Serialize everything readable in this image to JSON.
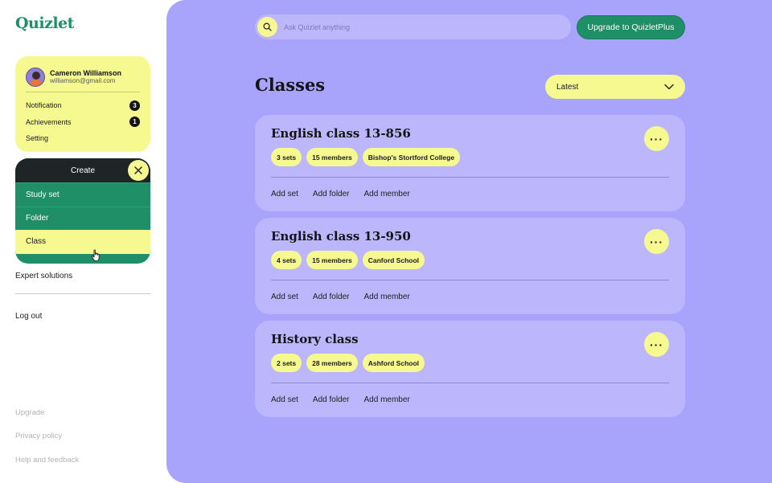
{
  "brand": {
    "logo": "Quizlet"
  },
  "profile": {
    "name": "Cameron Williamson",
    "email": "williamson@gmail.com",
    "items": [
      {
        "label": "Notification",
        "badge": "3"
      },
      {
        "label": "Achievements",
        "badge": "1"
      },
      {
        "label": "Setting",
        "badge": ""
      }
    ]
  },
  "create_menu": {
    "label": "Create",
    "items": [
      "Study set",
      "Folder",
      "Class"
    ],
    "active_item": "Class"
  },
  "sidebar": {
    "expert_solutions": "Expert solutions",
    "logout": "Log out",
    "footer": [
      "Upgrade",
      "Privacy policy",
      "Help and feedback"
    ]
  },
  "search": {
    "placeholder": "Ask Quizlet anything"
  },
  "upgrade_button": "Upgrade to QuizletPlus",
  "page": {
    "title": "Classes",
    "sort": "Latest"
  },
  "classes": [
    {
      "title": "English class 13-856",
      "chips": [
        "3 sets",
        "15  members",
        "Bishop's Stortford College"
      ],
      "actions": [
        "Add set",
        "Add folder",
        "Add member"
      ]
    },
    {
      "title": "English class 13-950",
      "chips": [
        "4 sets",
        "15  members",
        "Canford School"
      ],
      "actions": [
        "Add set",
        "Add folder",
        "Add member"
      ]
    },
    {
      "title": "History class",
      "chips": [
        "2 sets",
        "28 members",
        "Ashford School"
      ],
      "actions": [
        "Add set",
        "Add folder",
        "Add member"
      ]
    }
  ],
  "colors": {
    "brand_green": "#1f8f67",
    "panel_purple": "#a8a3fb",
    "card_purple": "#bcb7fc",
    "accent_yellow": "#f5f990",
    "dark": "#1f2427"
  },
  "icons": {
    "search": "search-icon",
    "close": "close-icon",
    "chevron": "chevron-down-icon",
    "more": "more-icon",
    "cursor": "hand-cursor-icon"
  }
}
